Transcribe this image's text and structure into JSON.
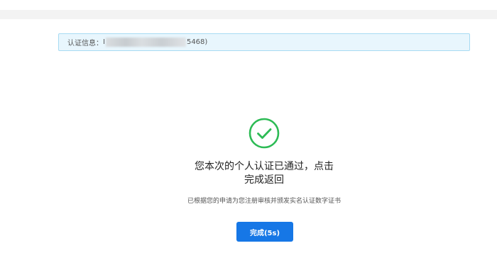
{
  "info_bar": {
    "label": "认证信息：",
    "value_prefix": "I",
    "value_suffix": "5468)"
  },
  "result": {
    "icon": "check-circle-icon",
    "success_color": "#2dbb55",
    "title_line1": "您本次的个人认证已通过，点击",
    "title_line2": "完成返回",
    "description": "已根据您的申请为您注册审核并颁发实名认证数字证书"
  },
  "actions": {
    "finish_label": "完成(5s)",
    "button_color": "#1677e6"
  }
}
